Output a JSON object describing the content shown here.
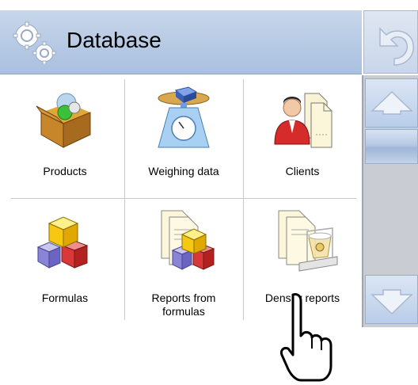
{
  "header": {
    "title": "Database"
  },
  "grid": {
    "items": [
      {
        "label": "Products",
        "icon": "products-box-icon"
      },
      {
        "label": "Weighing data",
        "icon": "scale-icon"
      },
      {
        "label": "Clients",
        "icon": "clients-icon"
      },
      {
        "label": "Formulas",
        "icon": "formulas-cubes-icon"
      },
      {
        "label": "Reports from formulas",
        "label_line1": "Reports from",
        "label_line2": "formulas",
        "icon": "formula-reports-icon"
      },
      {
        "label": "Density reports",
        "icon": "density-reports-icon"
      }
    ]
  },
  "sidebar": {
    "undo": "undo-icon",
    "scroll_up": "arrow-up-icon",
    "scroll_down": "arrow-down-icon"
  },
  "colors": {
    "header": "#b8cbe6",
    "scroll_track": "#c9cdd3",
    "button": "#c9d6ea"
  }
}
